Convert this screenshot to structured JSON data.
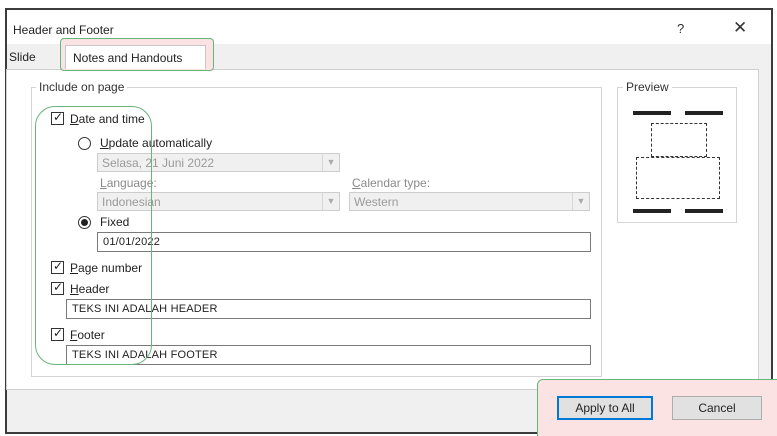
{
  "dialog": {
    "title": "Header and Footer",
    "help": "?",
    "close": "✕"
  },
  "tabs": {
    "slide": "Slide",
    "notes": "Notes and Handouts"
  },
  "include": {
    "legend": "Include on page",
    "date_time": {
      "label": "Date and time",
      "checked": true
    },
    "update_auto": {
      "label": "Update automatically",
      "selected": false,
      "date_value": "Selasa, 21 Juni 2022"
    },
    "language": {
      "label": "Language:",
      "value": "Indonesian"
    },
    "calendar": {
      "label": "Calendar type:",
      "value": "Western"
    },
    "fixed": {
      "label": "Fixed",
      "selected": true,
      "value": "01/01/2022"
    },
    "page_number": {
      "label": "Page number",
      "checked": true
    },
    "header": {
      "label": "Header",
      "checked": true,
      "value": "TEKS INI ADALAH HEADER"
    },
    "footer": {
      "label": "Footer",
      "checked": true,
      "value": "TEKS INI ADALAH FOOTER"
    }
  },
  "preview": {
    "legend": "Preview"
  },
  "buttons": {
    "apply_all": "Apply to All",
    "cancel": "Cancel"
  },
  "icons": {
    "check": "check-icon",
    "dropdown": "chevron-down-icon",
    "close": "close-icon"
  },
  "colors": {
    "accent": "#0078d7",
    "highlight_border": "#67b57a",
    "highlight_fill": "#fbe3e3"
  }
}
